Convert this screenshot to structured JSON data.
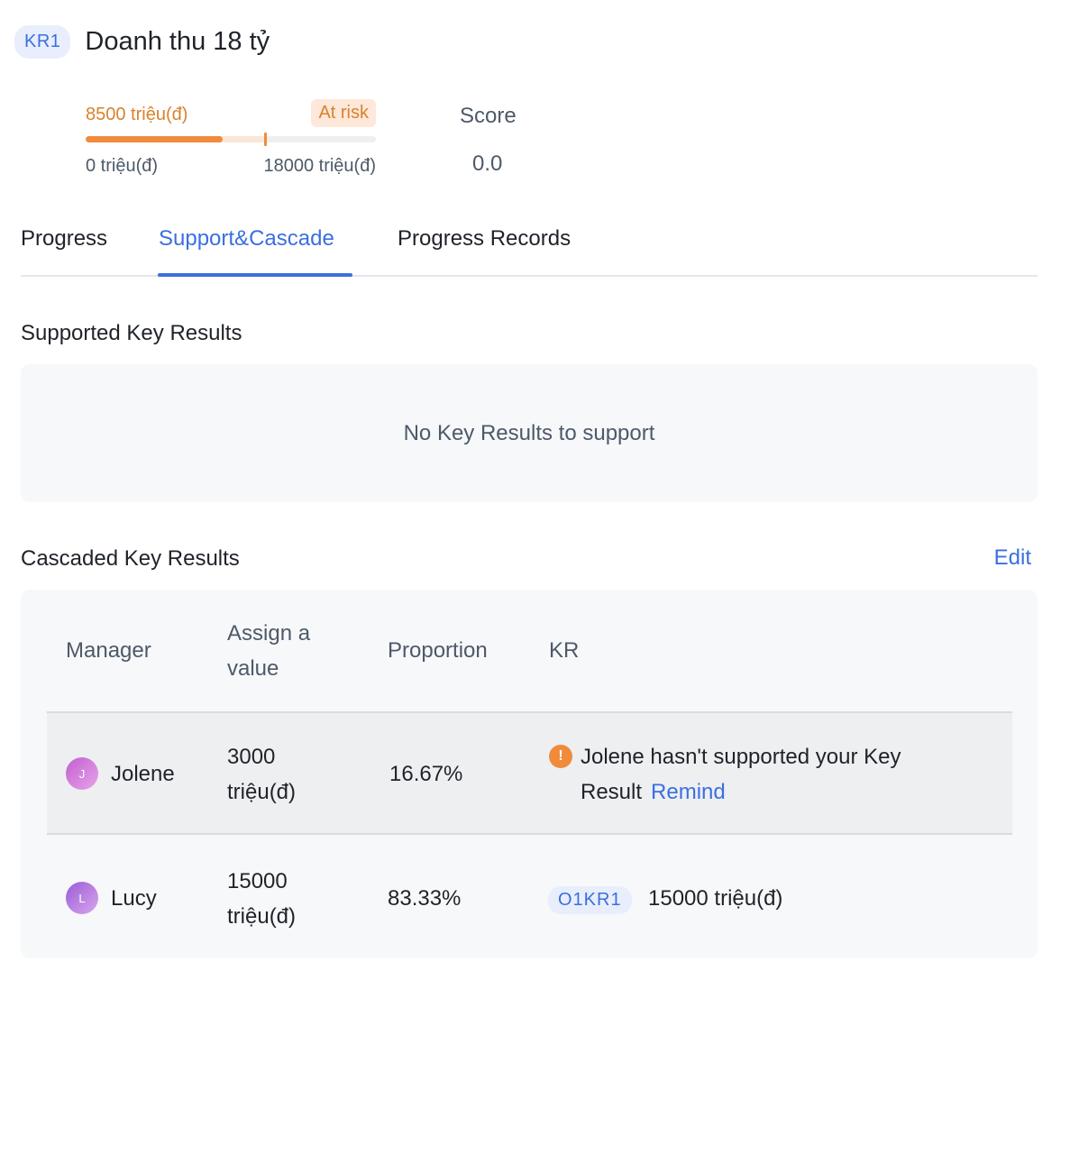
{
  "header": {
    "badge": "KR1",
    "title": "Doanh thu 18 tỷ"
  },
  "progress": {
    "current": "8500 triệu(đ)",
    "status": "At risk",
    "min": "0 triệu(đ)",
    "max": "18000 triệu(đ)",
    "current_fraction": 0.472,
    "expected_fraction": 0.62
  },
  "score": {
    "label": "Score",
    "value": "0.0"
  },
  "tabs": [
    {
      "label": "Progress"
    },
    {
      "label": "Support&Cascade"
    },
    {
      "label": "Progress Records"
    }
  ],
  "supported": {
    "title": "Supported Key Results",
    "empty_text": "No Key Results to support"
  },
  "cascaded": {
    "title": "Cascaded Key Results",
    "edit_label": "Edit",
    "columns": {
      "manager": "Manager",
      "assign_line1": "Assign a",
      "assign_line2": "value",
      "proportion": "Proportion",
      "kr": "KR"
    },
    "rows": [
      {
        "avatar": "J",
        "name": "Jolene",
        "value_line1": "3000",
        "value_line2": "triệu(đ)",
        "proportion": "16.67%",
        "warn_icon": "!",
        "message_line1": "Jolene hasn't supported your Key",
        "message_line2": "Result",
        "remind": "Remind"
      },
      {
        "avatar": "L",
        "name": "Lucy",
        "value_line1": "15000",
        "value_line2": "triệu(đ)",
        "proportion": "83.33%",
        "kr_badge": "O1KR1",
        "kr_value": "15000 triệu(đ)"
      }
    ]
  },
  "colors": {
    "accent": "#3b6fe0",
    "warning": "#f08b3c"
  }
}
